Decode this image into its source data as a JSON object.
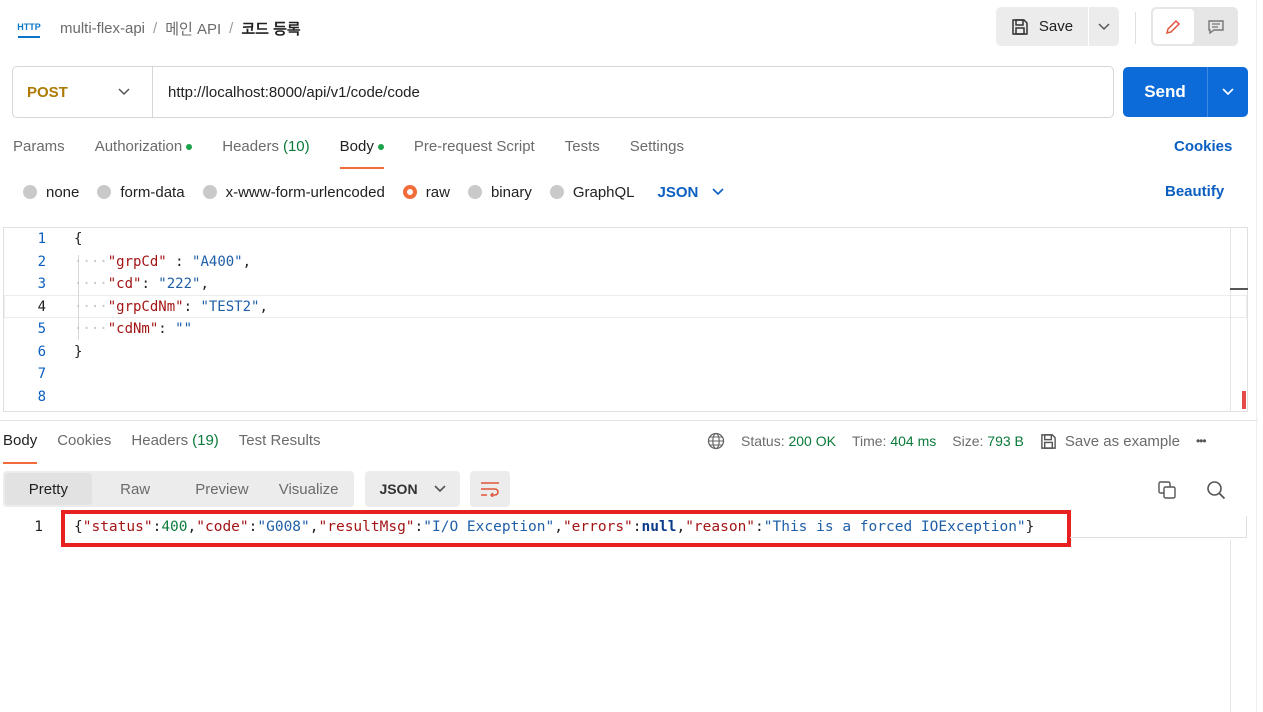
{
  "header": {
    "icon": "http-icon",
    "icon_text": "HTTP",
    "breadcrumbs": [
      "multi-flex-api",
      "메인 API",
      "코드 등록"
    ],
    "separator": "/",
    "save_label": "Save"
  },
  "request": {
    "method": "POST",
    "url": "http://localhost:8000/api/v1/code/code",
    "send_label": "Send"
  },
  "request_tabs": [
    {
      "label": "Params"
    },
    {
      "label": "Authorization",
      "dot": true
    },
    {
      "label": "Headers",
      "count": "(10)"
    },
    {
      "label": "Body",
      "dot": true,
      "active": true
    },
    {
      "label": "Pre-request Script"
    },
    {
      "label": "Tests"
    },
    {
      "label": "Settings"
    }
  ],
  "cookies_label": "Cookies",
  "body_types": [
    "none",
    "form-data",
    "x-www-form-urlencoded",
    "raw",
    "binary",
    "GraphQL"
  ],
  "body_type_selected": "raw",
  "body_format": "JSON",
  "beautify_label": "Beautify",
  "editor": {
    "line_numbers": [
      "1",
      "2",
      "3",
      "4",
      "5",
      "6",
      "7",
      "8"
    ],
    "lines": {
      "l1": "{",
      "l2_key": "\"grpCd\"",
      "l2_sep": " : ",
      "l2_val": "\"A400\"",
      "l2_end": ",",
      "l3_key": "\"cd\"",
      "l3_sep": ": ",
      "l3_val": "\"222\"",
      "l3_end": ",",
      "l4_key": "\"grpCdNm\"",
      "l4_sep": ": ",
      "l4_val": "\"TEST2\"",
      "l4_end": ",",
      "l5_key": "\"cdNm\"",
      "l5_sep": ": ",
      "l5_val": "\"\"",
      "l6": "}"
    }
  },
  "response_tabs": [
    {
      "label": "Body",
      "active": true
    },
    {
      "label": "Cookies"
    },
    {
      "label": "Headers",
      "count": "(19)"
    },
    {
      "label": "Test Results"
    }
  ],
  "response_meta": {
    "status_label": "Status:",
    "status_value": "200 OK",
    "time_label": "Time:",
    "time_value": "404 ms",
    "size_label": "Size:",
    "size_value": "793 B",
    "save_example": "Save as example",
    "more": "•••"
  },
  "response_views": [
    "Pretty",
    "Raw",
    "Preview",
    "Visualize"
  ],
  "response_view_selected": "Pretty",
  "response_format": "JSON",
  "response_body": {
    "line_number": "1",
    "t0": "{",
    "k_status": "\"status\"",
    "c1": ":",
    "v_status": "400",
    "p1": ",",
    "k_code": "\"code\"",
    "c2": ":",
    "v_code": "\"G008\"",
    "p2": ",",
    "k_msg": "\"resultMsg\"",
    "c3": ":",
    "v_msg": "\"I/O Exception\"",
    "p3": ",",
    "k_err": "\"errors\"",
    "c4": ":",
    "v_err": "null",
    "p4": ",",
    "k_reason": "\"reason\"",
    "c5": ":",
    "v_reason": "\"This is a forced IOException\"",
    "t1": "}"
  },
  "colors": {
    "accent": "#f26b3a",
    "send_blue": "#0c6bd9",
    "link_blue": "#0b5fc1",
    "method_post": "#ad7a03",
    "status_ok": "#0a7a3a",
    "highlight_box": "#e82020"
  }
}
